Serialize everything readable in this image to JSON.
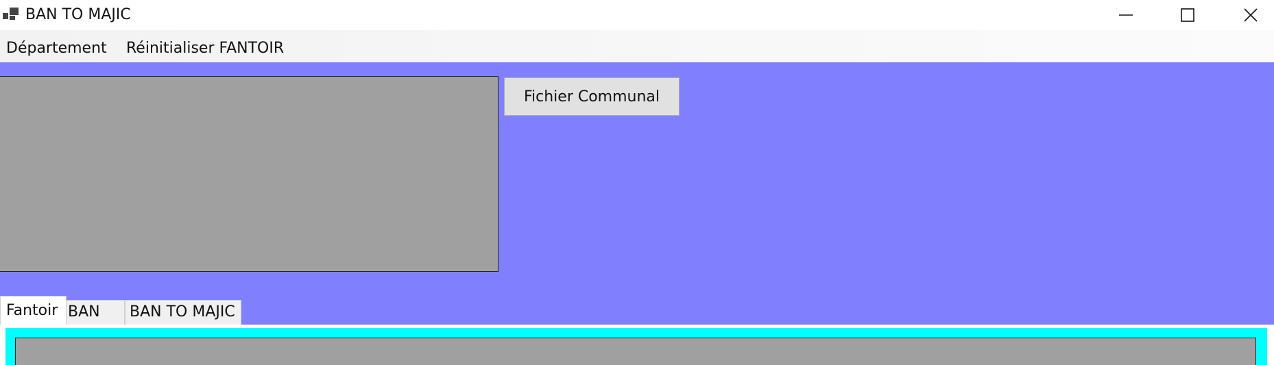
{
  "window": {
    "title": "BAN TO MAJIC",
    "icon": "app-window-icon",
    "controls": {
      "minimize_icon": "minimize-icon",
      "maximize_icon": "maximize-icon",
      "close_icon": "close-icon"
    }
  },
  "menu": {
    "items": [
      {
        "label": "Département"
      },
      {
        "label": "Réinitialiser FANTOIR"
      }
    ]
  },
  "main": {
    "background_color": "#8080ff",
    "communal_button_label": "Fichier Communal"
  },
  "tabs": {
    "items": [
      {
        "label": "Fantoir",
        "active": true
      },
      {
        "label": "BAN",
        "active": false
      },
      {
        "label": "BAN TO MAJIC",
        "active": false
      }
    ],
    "panel_color": "#00ffff"
  }
}
